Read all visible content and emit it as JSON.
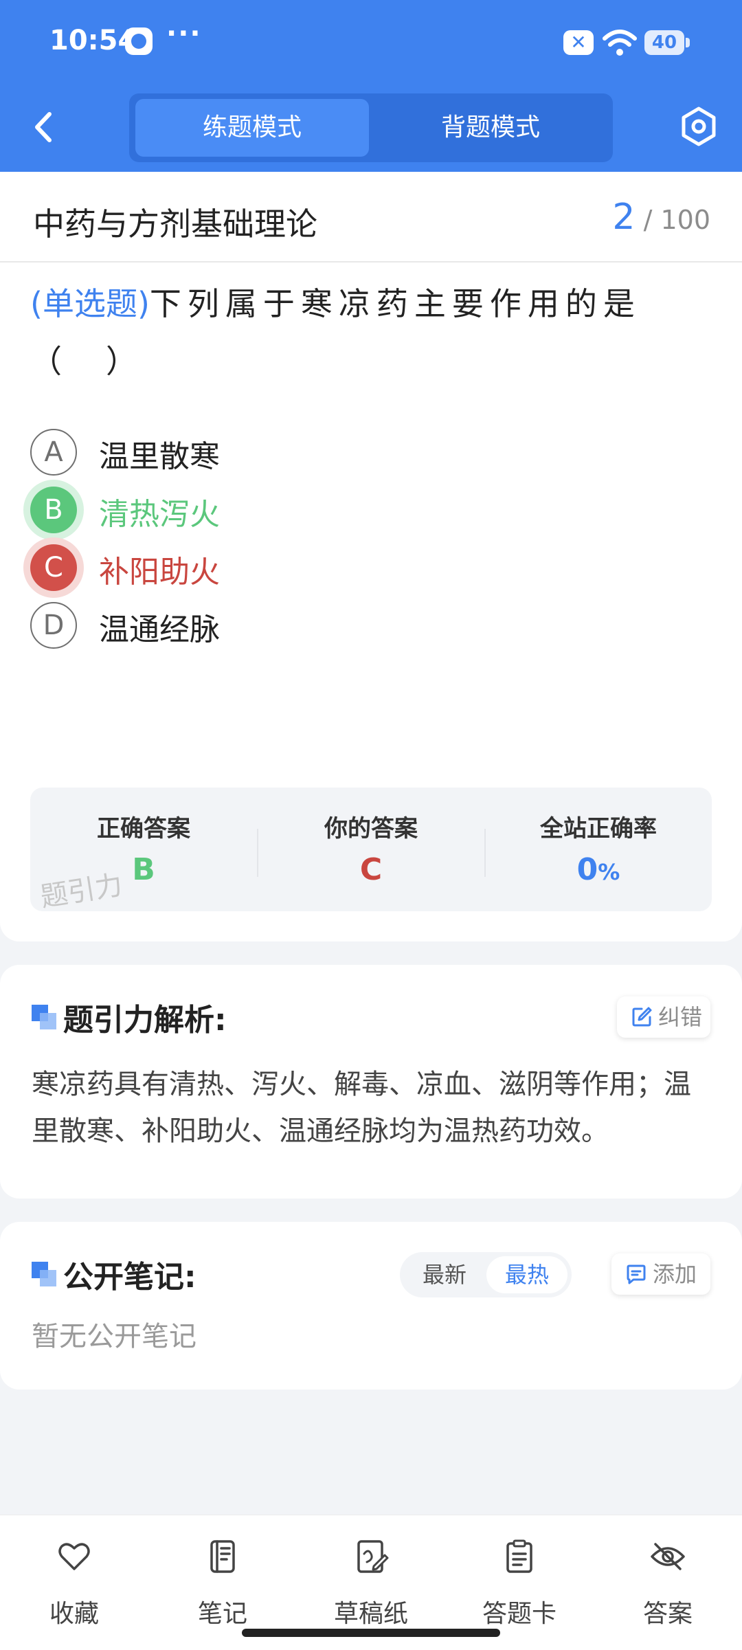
{
  "status_bar": {
    "time": "10:54",
    "more": "···",
    "battery": "40"
  },
  "header": {
    "modes": [
      "练题模式",
      "背题模式"
    ],
    "active_mode": 0
  },
  "question": {
    "subject": "中药与方剂基础理论",
    "current": "2",
    "total": "/ 100",
    "type_label": "(单选题)",
    "text": "下列属于寒凉药主要作用的是（　）",
    "options": [
      {
        "letter": "A",
        "text": "温里散寒",
        "state": "normal"
      },
      {
        "letter": "B",
        "text": "清热泻火",
        "state": "correct"
      },
      {
        "letter": "C",
        "text": "补阳助火",
        "state": "wrong"
      },
      {
        "letter": "D",
        "text": "温通经脉",
        "state": "normal"
      }
    ]
  },
  "stats": {
    "correct_label": "正确答案",
    "correct_value": "B",
    "yours_label": "你的答案",
    "yours_value": "C",
    "rate_label": "全站正确率",
    "rate_value": "0",
    "rate_unit": "%",
    "watermark": "题引力"
  },
  "analysis": {
    "title": "题引力解析:",
    "report_label": "纠错",
    "text": "寒凉药具有清热、泻火、解毒、凉血、滋阴等作用；温里散寒、补阳助火、温通经脉均为温热药功效。"
  },
  "notes": {
    "title": "公开笔记:",
    "sort_latest": "最新",
    "sort_hot": "最热",
    "add_label": "添加",
    "empty": "暂无公开笔记"
  },
  "bottom_nav": [
    {
      "label": "收藏",
      "icon": "heart-icon"
    },
    {
      "label": "笔记",
      "icon": "notebook-icon"
    },
    {
      "label": "草稿纸",
      "icon": "draft-paper-icon"
    },
    {
      "label": "答题卡",
      "icon": "answer-card-icon"
    },
    {
      "label": "答案",
      "icon": "eye-off-icon"
    }
  ],
  "colors": {
    "primary": "#3f82ef",
    "correct": "#5bc77c",
    "wrong": "#d2504a"
  }
}
